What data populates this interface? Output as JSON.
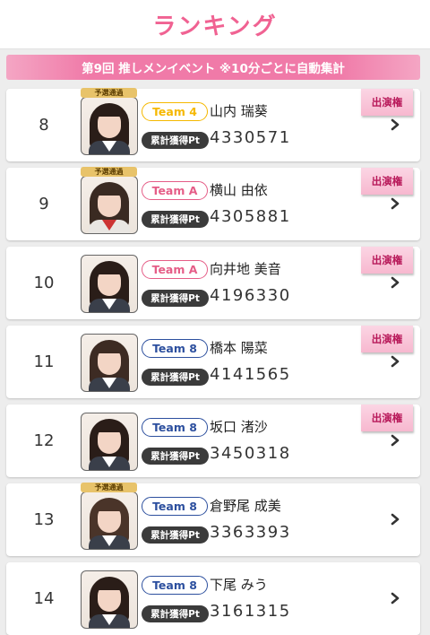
{
  "header": {
    "title": "ランキング"
  },
  "banner": {
    "text": "第9回 推しメンイベント ※10分ごとに自動集計"
  },
  "colors": {
    "accent_pink": "#f06292",
    "team_4": "#f5b800",
    "team_a": "#e55d87",
    "team_8": "#2c4f9e"
  },
  "rows": [
    {
      "rank": "8",
      "team": "Team 4",
      "name": "山内 瑞葵",
      "pt_label": "累計獲得Pt",
      "points": "4330571",
      "prelim": "予選通過",
      "badge": "出演権"
    },
    {
      "rank": "9",
      "team": "Team A",
      "name": "横山 由依",
      "pt_label": "累計獲得Pt",
      "points": "4305881",
      "prelim": "予選通過",
      "badge": "出演権"
    },
    {
      "rank": "10",
      "team": "Team A",
      "name": "向井地 美音",
      "pt_label": "累計獲得Pt",
      "points": "4196330",
      "badge": "出演権"
    },
    {
      "rank": "11",
      "team": "Team 8",
      "name": "橋本 陽菜",
      "pt_label": "累計獲得Pt",
      "points": "4141565",
      "badge": "出演権"
    },
    {
      "rank": "12",
      "team": "Team 8",
      "name": "坂口 渚沙",
      "pt_label": "累計獲得Pt",
      "points": "3450318",
      "badge": "出演権"
    },
    {
      "rank": "13",
      "team": "Team 8",
      "name": "倉野尾 成美",
      "pt_label": "累計獲得Pt",
      "points": "3363393",
      "prelim": "予選通過"
    },
    {
      "rank": "14",
      "team": "Team 8",
      "name": "下尾 みう",
      "pt_label": "累計獲得Pt",
      "points": "3161315"
    }
  ]
}
